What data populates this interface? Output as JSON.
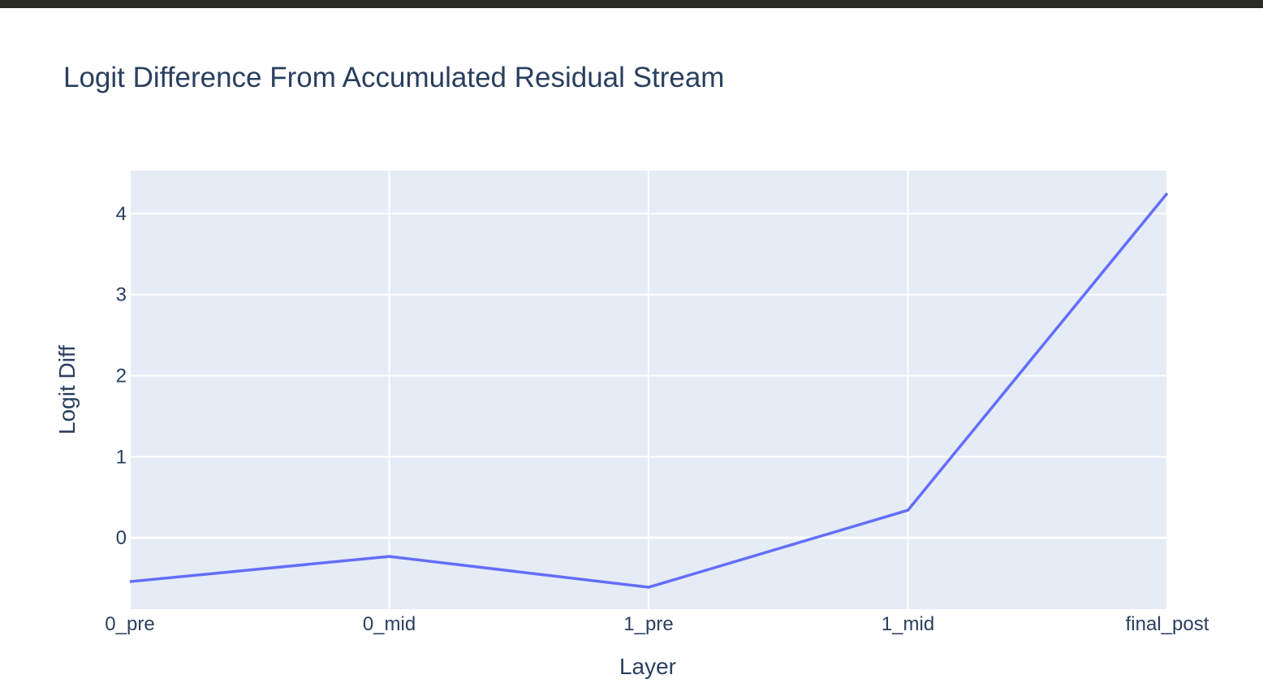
{
  "chart_data": {
    "type": "line",
    "title": "Logit Difference From Accumulated Residual Stream",
    "xlabel": "Layer",
    "ylabel": "Logit Diff",
    "categories": [
      "0_pre",
      "0_mid",
      "1_pre",
      "1_mid",
      "final_post"
    ],
    "series": [
      {
        "values": [
          -0.54,
          -0.23,
          -0.61,
          0.34,
          4.25
        ]
      }
    ],
    "yticks": [
      0,
      1,
      2,
      3,
      4
    ],
    "ylim": [
      -0.88,
      4.53
    ],
    "grid": true,
    "legend": "none",
    "colors": {
      "line": "#636efa",
      "plot_bg": "#e5ecf6",
      "grid": "#ffffff",
      "text": "#2a3f5f"
    }
  }
}
